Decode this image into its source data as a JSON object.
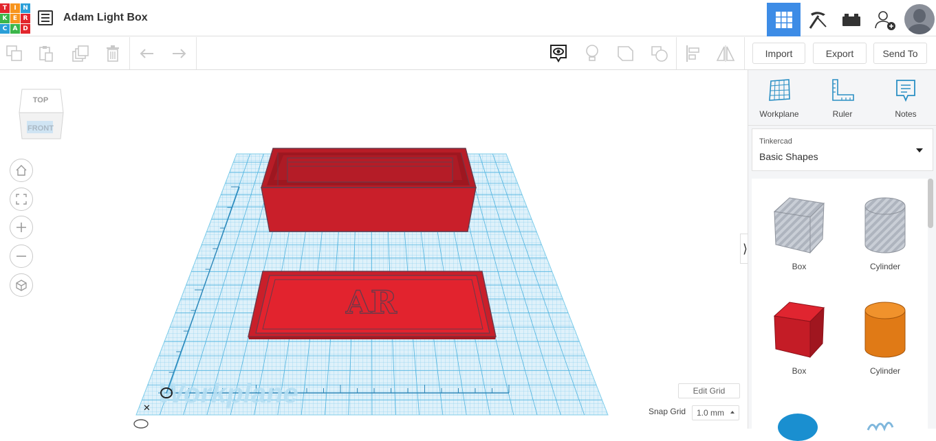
{
  "app": {
    "logo_letters": [
      "T",
      "I",
      "N",
      "K",
      "E",
      "R",
      "C",
      "A",
      "D"
    ],
    "logo_colors": [
      "#e2252c",
      "#f7941d",
      "#2a9fd8",
      "#3bb54a",
      "#f7941d",
      "#e2252c",
      "#2a9fd8",
      "#3bb54a",
      "#e2252c"
    ],
    "title": "Adam Light Box"
  },
  "header": {
    "icons": [
      "grid-view-icon",
      "pickaxe-icon",
      "bricks-icon",
      "add-user-icon",
      "avatar"
    ],
    "active_color": "#3d8ce6"
  },
  "toolbar": {
    "import_label": "Import",
    "export_label": "Export",
    "send_to_label": "Send To"
  },
  "viewcube": {
    "top_label": "TOP",
    "front_label": "FRONT"
  },
  "workplane": {
    "label": "Workplane",
    "grid_color": "#6cc6e8",
    "object_color": "#d8232f",
    "lid_text": "AR"
  },
  "grid_controls": {
    "edit_grid_label": "Edit Grid",
    "snap_grid_label": "Snap Grid",
    "snap_value": "1.0 mm"
  },
  "panel": {
    "tools": [
      {
        "label": "Workplane",
        "icon": "workplane-icon"
      },
      {
        "label": "Ruler",
        "icon": "ruler-icon"
      },
      {
        "label": "Notes",
        "icon": "notes-icon"
      }
    ],
    "library": {
      "provider": "Tinkercad",
      "selected": "Basic Shapes"
    },
    "shapes": [
      {
        "label": "Box",
        "color": "hole"
      },
      {
        "label": "Cylinder",
        "color": "hole"
      },
      {
        "label": "Box",
        "color": "#d11e25"
      },
      {
        "label": "Cylinder",
        "color": "#e67e1a"
      }
    ]
  }
}
